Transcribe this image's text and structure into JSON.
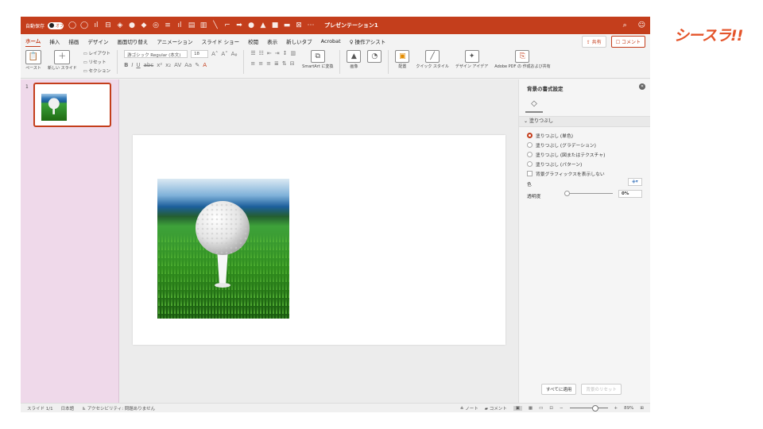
{
  "titlebar": {
    "autosave_label": "自動保存",
    "autosave_state": "オフ",
    "doc_title": "プレゼンテーション1",
    "search_icon": "magnifier",
    "help_icon": "person-help"
  },
  "tabs": [
    "ホーム",
    "挿入",
    "描画",
    "デザイン",
    "画面切り替え",
    "アニメーション",
    "スライド ショー",
    "校閲",
    "表示",
    "新しいタブ",
    "Acrobat",
    "操作アシスト"
  ],
  "share_label": "共有",
  "comment_label": "コメント",
  "ribbon": {
    "paste": "ペースト",
    "new_slide": "新しい スライド",
    "layout": "レイアウト",
    "reset": "リセット",
    "section": "セクション",
    "font_name": "游ゴシック Regular (本文)",
    "font_size": "18",
    "convert_smartart": "SmartArt に変換",
    "image": "画像",
    "arrange": "配置",
    "quick_styles": "クイック スタイル",
    "design_ideas": "デザイン アイデア",
    "adobe_pdf": "Adobe PDF の 作成および共有"
  },
  "thumbnails": {
    "slide_number": "1"
  },
  "pane": {
    "title": "背景の書式設定",
    "section": "塗りつぶし",
    "options": [
      {
        "label": "塗りつぶし (単色)",
        "selected": true
      },
      {
        "label": "塗りつぶし (グラデーション)",
        "selected": false
      },
      {
        "label": "塗りつぶし (図またはテクスチャ)",
        "selected": false
      },
      {
        "label": "塗りつぶし (パターン)",
        "selected": false
      }
    ],
    "hide_graphics": "背景グラフィックスを表示しない",
    "color_label": "色",
    "transparency_label": "透明度",
    "transparency_value": "0%",
    "apply_all": "すべてに適用",
    "reset_bg": "背景のリセット"
  },
  "status": {
    "slide_pos": "スライド 1/1",
    "language": "日本語",
    "accessibility": "アクセシビリティ: 問題ありません",
    "notes": "ノート",
    "comments": "コメント",
    "zoom": "89%"
  },
  "brand": "シースラ!!",
  "colors": {
    "accent": "#c43e1c",
    "thumb_bg": "#efd9ea",
    "brand": "#e4542a"
  }
}
